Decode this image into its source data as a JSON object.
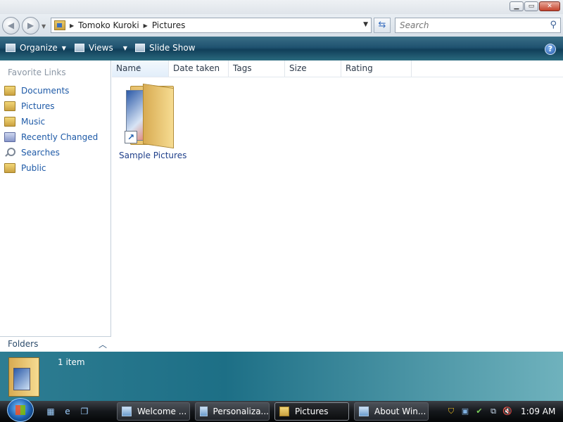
{
  "window": {
    "nav": {
      "back_icon": "back-arrow-icon",
      "forward_icon": "forward-arrow-icon"
    },
    "address": {
      "crumbs": [
        "Tomoko Kuroki",
        "Pictures"
      ]
    },
    "search": {
      "placeholder": "Search"
    },
    "toolbar": {
      "organize": "Organize",
      "views": "Views",
      "slideshow": "Slide Show"
    },
    "nav_pane": {
      "heading": "Favorite Links",
      "links": [
        "Documents",
        "Pictures",
        "Music",
        "Recently Changed",
        "Searches",
        "Public"
      ],
      "folders_label": "Folders"
    },
    "columns": [
      "Name",
      "Date taken",
      "Tags",
      "Size",
      "Rating"
    ],
    "items": [
      {
        "label": "Sample Pictures"
      }
    ],
    "details": {
      "count": "1 item"
    }
  },
  "taskbar": {
    "tasks": [
      "Welcome ...",
      "Personaliza...",
      "Pictures",
      "About Win..."
    ],
    "active_task": "Pictures",
    "clock": "1:09 AM"
  },
  "colors": {
    "link": "#1e5aa7",
    "toolbar": "#1f5270",
    "details_pane": "#1d6f86"
  }
}
